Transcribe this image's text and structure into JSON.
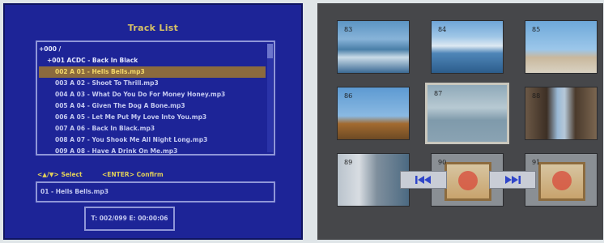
{
  "track_list": {
    "title": "Track List",
    "root_label": "+000 /",
    "folder_label": "+001 ACDC - Back In Black",
    "items": [
      {
        "label": "002 A 01 - Hells Bells.mp3",
        "selected": true
      },
      {
        "label": "003 A 02 - Shoot To Thrill.mp3",
        "selected": false
      },
      {
        "label": "004 A 03 - What Do You Do For Money Honey.mp3",
        "selected": false
      },
      {
        "label": "005 A 04 - Given The Dog A Bone.mp3",
        "selected": false
      },
      {
        "label": "006 A 05 - Let Me Put My Love Into You.mp3",
        "selected": false
      },
      {
        "label": "007 A 06 - Back In Black.mp3",
        "selected": false
      },
      {
        "label": "008 A 07 - You Shook Me All Night Long.mp3",
        "selected": false
      },
      {
        "label": "009 A 08 - Have A Drink On Me.mp3",
        "selected": false
      }
    ],
    "hint_select": "<▲/▼> Select",
    "hint_confirm": "<ENTER> Confirm",
    "now_playing": "01 - Hells Bells.mp3",
    "time": "T: 002/099 E: 00:00:06"
  },
  "photo_grid": {
    "thumbnails": [
      {
        "number": "83",
        "scene": "sea"
      },
      {
        "number": "84",
        "scene": "sea2"
      },
      {
        "number": "85",
        "scene": "shore"
      },
      {
        "number": "86",
        "scene": "trees"
      },
      {
        "number": "87",
        "scene": "lake",
        "selected": true
      },
      {
        "number": "88",
        "scene": "street"
      },
      {
        "number": "89",
        "scene": "canal"
      },
      {
        "number": "90",
        "scene": "mural"
      },
      {
        "number": "91",
        "scene": "mural"
      }
    ],
    "prev_button_icon": "skip-back-icon",
    "next_button_icon": "skip-forward-icon"
  },
  "colors": {
    "menu_background": "#1d2497",
    "selection_highlight": "#8b6a3e",
    "title_text": "#d6c266",
    "grid_background": "#46474a",
    "nav_icon": "#2f45c9"
  }
}
